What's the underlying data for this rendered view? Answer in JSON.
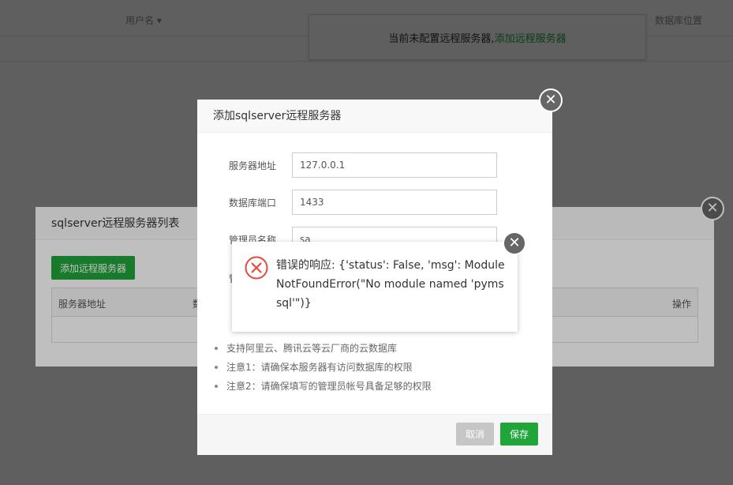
{
  "background": {
    "header_columns": [
      "用户名",
      "数据库位置"
    ],
    "notice_prefix": "当前未配置远程服务器,",
    "notice_link": "添加远程服务器"
  },
  "list_dialog": {
    "title": "sqlserver远程服务器列表",
    "add_button": "添加远程服务器",
    "columns": {
      "host": "服务器地址",
      "partial": "数",
      "action": "操作"
    }
  },
  "add_dialog": {
    "title": "添加sqlserver远程服务器",
    "fields": {
      "host": {
        "label": "服务器地址",
        "value": "127.0.0.1"
      },
      "port": {
        "label": "数据库端口",
        "value": "1433"
      },
      "admin": {
        "label": "管理员名称",
        "value": "sa"
      },
      "partial_label": "管"
    },
    "tips": [
      "支持阿里云、腾讯云等云厂商的云数据库",
      "注意1：请确保本服务器有访问数据库的权限",
      "注意2：请确保填写的管理员帐号具备足够的权限"
    ],
    "cancel_label": "取消",
    "save_label": "保存"
  },
  "error_message": {
    "text": "错误的响应: {'status': False, 'msg': ModuleNotFoundError(\"No module named 'pymssql'\")}"
  },
  "colors": {
    "brand_green": "#20a53a",
    "error_red": "#e64a3b"
  },
  "icons": [
    "chevron-down-icon",
    "close-icon",
    "error-icon"
  ]
}
